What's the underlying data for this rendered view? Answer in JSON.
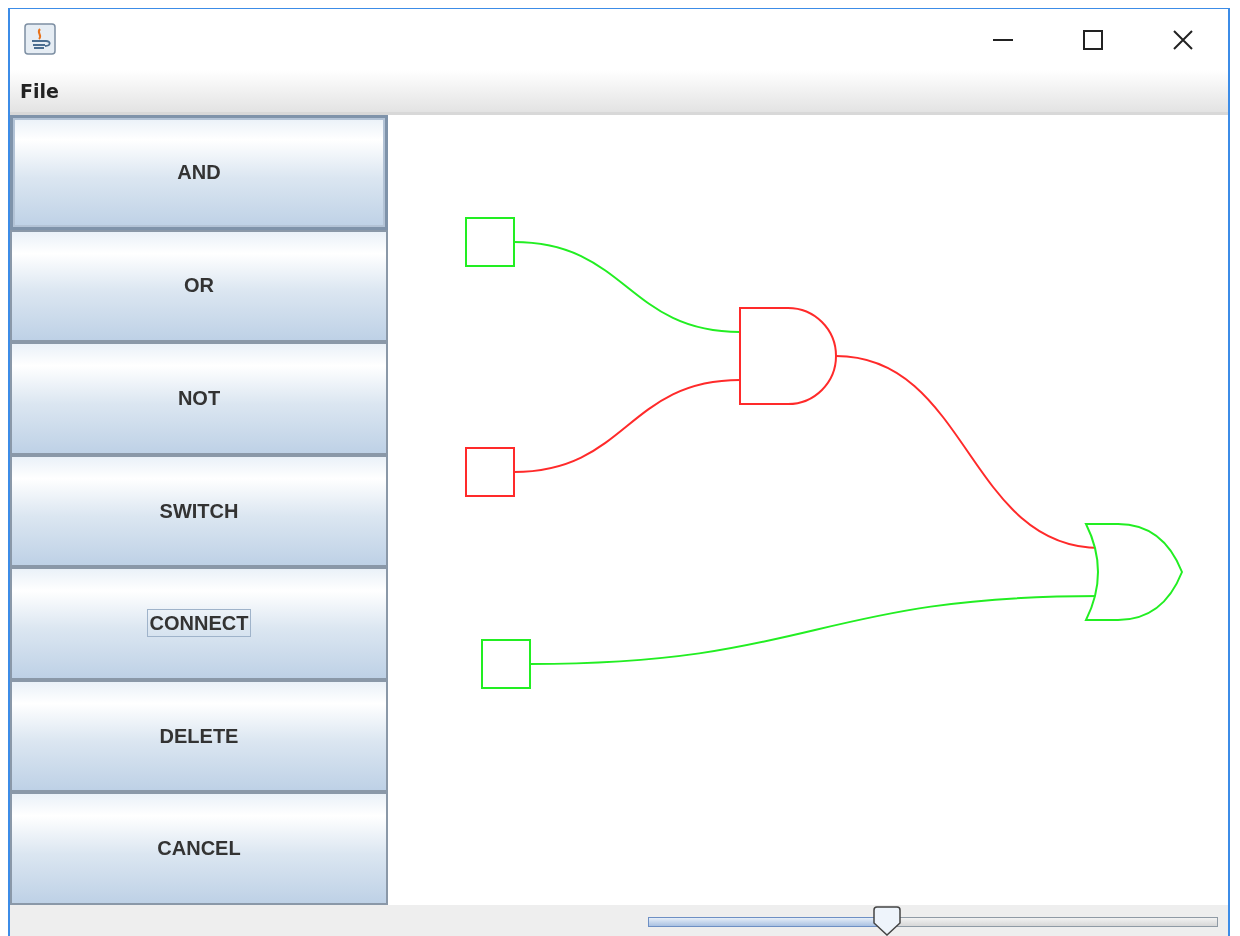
{
  "menu": [
    "File"
  ],
  "buttons": [
    {
      "label": "AND",
      "selected": true,
      "focused": false
    },
    {
      "label": "OR",
      "selected": false,
      "focused": false
    },
    {
      "label": "NOT",
      "selected": false,
      "focused": false
    },
    {
      "label": "SWITCH",
      "selected": false,
      "focused": false
    },
    {
      "label": "CONNECT",
      "selected": false,
      "focused": true
    },
    {
      "label": "DELETE",
      "selected": false,
      "focused": false
    },
    {
      "label": "CANCEL",
      "selected": false,
      "focused": false
    }
  ],
  "circuit": {
    "components": [
      {
        "kind": "switch",
        "on": true
      },
      {
        "kind": "switch",
        "on": false
      },
      {
        "kind": "switch",
        "on": true
      },
      {
        "kind": "and",
        "on": false
      },
      {
        "kind": "or",
        "on": true
      }
    ],
    "wires": [
      {
        "on": true
      },
      {
        "on": false
      },
      {
        "on": false
      },
      {
        "on": true
      }
    ]
  },
  "zoom_slider": {
    "level": 0.42
  }
}
